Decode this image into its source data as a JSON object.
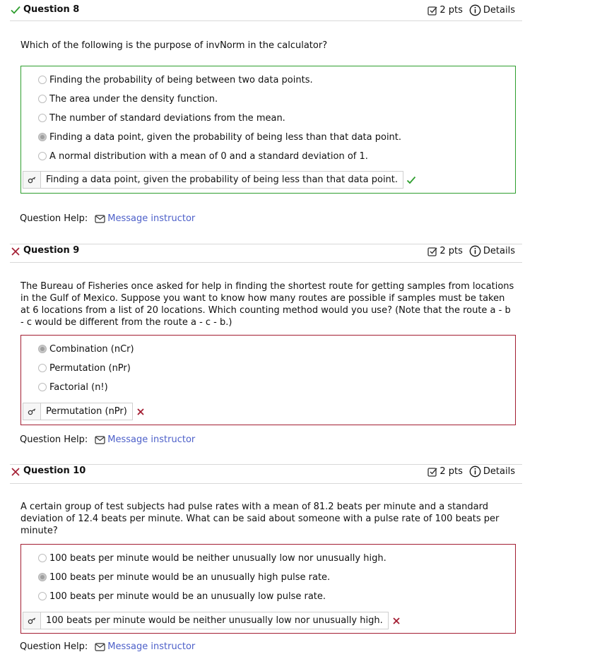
{
  "questions": [
    {
      "title": "Question 8",
      "status": "correct",
      "points": "2 pts",
      "details_label": "Details",
      "text": "Which of the following is the purpose of invNorm in the calculator?",
      "options": [
        {
          "label": "Finding the probability of being between two data points.",
          "selected": false
        },
        {
          "label": "The area under the density function.",
          "selected": false
        },
        {
          "label": "The number of standard deviations from the mean.",
          "selected": false
        },
        {
          "label": "Finding a data point, given the probability of being less than that data point.",
          "selected": true
        },
        {
          "label": "A normal distribution with a mean of 0 and a standard deviation of 1.",
          "selected": false
        }
      ],
      "submitted_answer": "Finding a data point, given the probability of being less than that data point.",
      "help_label": "Question Help:",
      "help_link": "Message instructor"
    },
    {
      "title": "Question 9",
      "status": "incorrect",
      "points": "2 pts",
      "details_label": "Details",
      "text": "The Bureau of Fisheries once asked for help in finding the shortest route for getting samples from locations in the Gulf of Mexico. Suppose you want to know how many routes are possible if samples must be taken at 6 locations from a list of 20 locations. Which counting method would you use? (Note that the route a - b - c would be different from the route a - c - b.)",
      "options": [
        {
          "label": "Combination (nCr)",
          "selected": true
        },
        {
          "label": "Permutation (nPr)",
          "selected": false
        },
        {
          "label": "Factorial (n!)",
          "selected": false
        }
      ],
      "submitted_answer": "Permutation (nPr)",
      "help_label": "Question Help:",
      "help_link": "Message instructor"
    },
    {
      "title": "Question 10",
      "status": "incorrect",
      "points": "2 pts",
      "details_label": "Details",
      "text": "A certain group of test subjects had pulse rates with a mean of 81.2 beats per minute and a standard deviation of 12.4 beats per minute. What can be said about someone with a pulse rate of 100 beats per minute?",
      "options": [
        {
          "label": "100 beats per minute would be neither unusually low nor unusually high.",
          "selected": false
        },
        {
          "label": "100 beats per minute would be an unusually high pulse rate.",
          "selected": true
        },
        {
          "label": "100 beats per minute would be an unusually low pulse rate.",
          "selected": false
        }
      ],
      "submitted_answer": "100 beats per minute would be neither unusually low nor unusually high.",
      "help_label": "Question Help:",
      "help_link": "Message instructor"
    }
  ],
  "colors": {
    "correct": "#2e9e2e",
    "incorrect": "#a31d32",
    "link": "#4d60c9"
  }
}
